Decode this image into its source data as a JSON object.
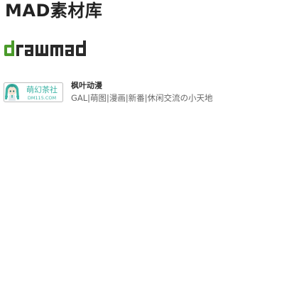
{
  "page": {
    "title": "MAD素材库"
  },
  "logo": {
    "text": "drawmad",
    "accent_color": "#4a9a2a",
    "text_color": "#2b2b2b"
  },
  "links": [
    {
      "name": "枫叶动漫",
      "description": "GAL|萌图|漫画|新番|休闲交流の小天地",
      "banner": {
        "title": "萌幻茶社",
        "subtitle": "DM115.COM",
        "accent_color": "#3fb4a6",
        "icon": "anime-girl-mascot-icon"
      }
    }
  ]
}
